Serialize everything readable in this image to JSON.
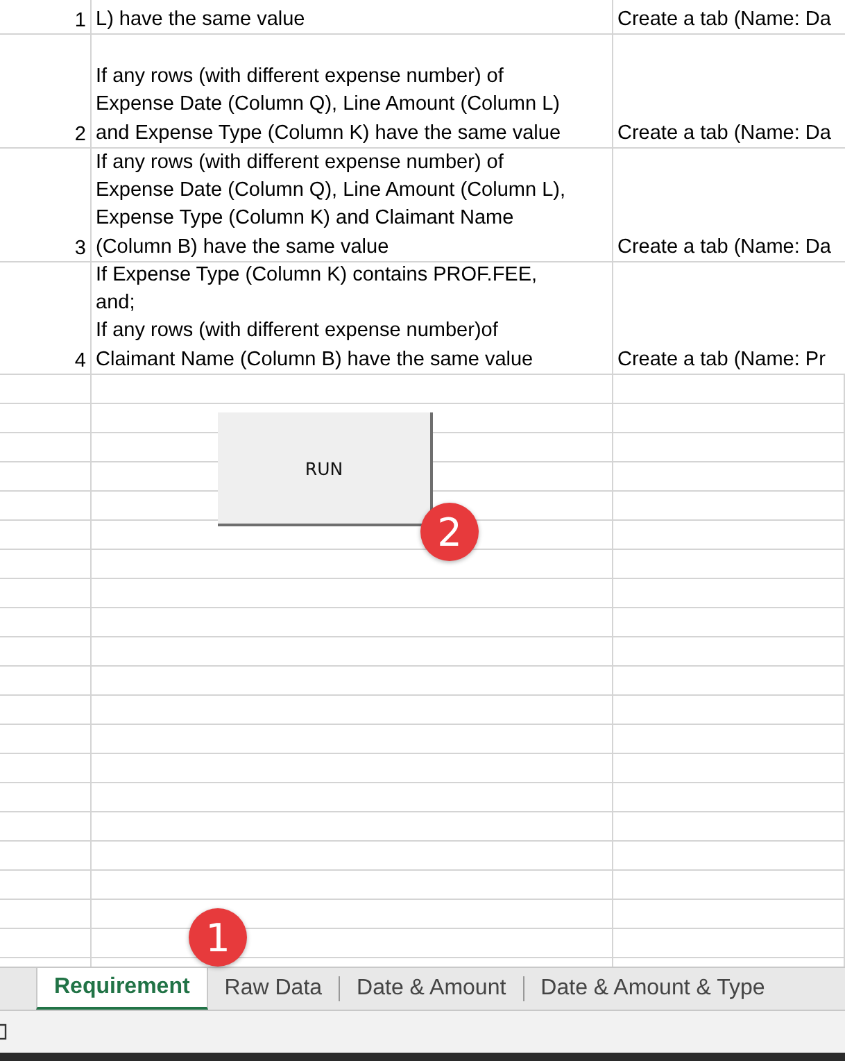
{
  "rows": [
    {
      "number": "1",
      "condition": "L) have the same value",
      "action": "Create a tab (Name: Da"
    },
    {
      "number": "2",
      "condition": "If any rows (with different expense number) of\nExpense Date (Column Q), Line Amount (Column L)\nand Expense Type (Column K) have the same value",
      "action": "Create a tab (Name: Da"
    },
    {
      "number": "3",
      "condition": "If any rows (with different expense number) of\nExpense Date (Column Q), Line Amount (Column L),\nExpense Type (Column K) and Claimant Name\n(Column B) have the same value",
      "action": "Create a tab (Name: Da"
    },
    {
      "number": "4",
      "condition": "If Expense Type (Column K) contains PROF.FEE,\nand;\nIf any rows (with different expense number)of\nClaimant Name (Column B) have the same value",
      "action": "Create a tab (Name: Pr"
    }
  ],
  "run_button": {
    "label": "RUN"
  },
  "callouts": [
    "1",
    "2"
  ],
  "sheet_tabs": [
    {
      "label": "Requirement",
      "selected": true
    },
    {
      "label": "Raw Data",
      "selected": false
    },
    {
      "label": "Date & Amount",
      "selected": false
    },
    {
      "label": "Date & Amount & Type",
      "selected": false
    }
  ]
}
